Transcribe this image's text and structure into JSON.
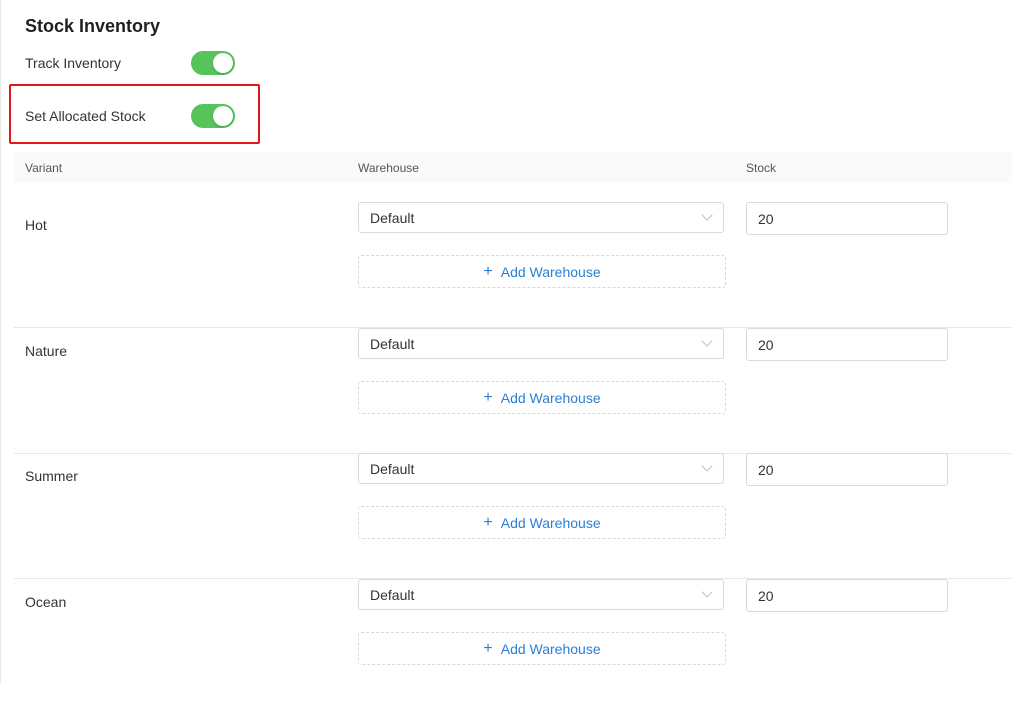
{
  "section": {
    "title": "Stock Inventory"
  },
  "toggles": [
    {
      "label": "Track Inventory",
      "on": true
    },
    {
      "label": "Set Allocated Stock",
      "on": true
    }
  ],
  "table": {
    "headers": {
      "variant": "Variant",
      "warehouse": "Warehouse",
      "stock": "Stock"
    },
    "add_warehouse_label": "Add Warehouse",
    "rows": [
      {
        "variant": "Hot",
        "warehouse": "Default",
        "stock": "20"
      },
      {
        "variant": "Nature",
        "warehouse": "Default",
        "stock": "20"
      },
      {
        "variant": "Summer",
        "warehouse": "Default",
        "stock": "20"
      },
      {
        "variant": "Ocean",
        "warehouse": "Default",
        "stock": "20"
      }
    ]
  },
  "colors": {
    "toggle_on": "#56c35b",
    "highlight": "#e4161c",
    "link": "#2a7fd4"
  }
}
